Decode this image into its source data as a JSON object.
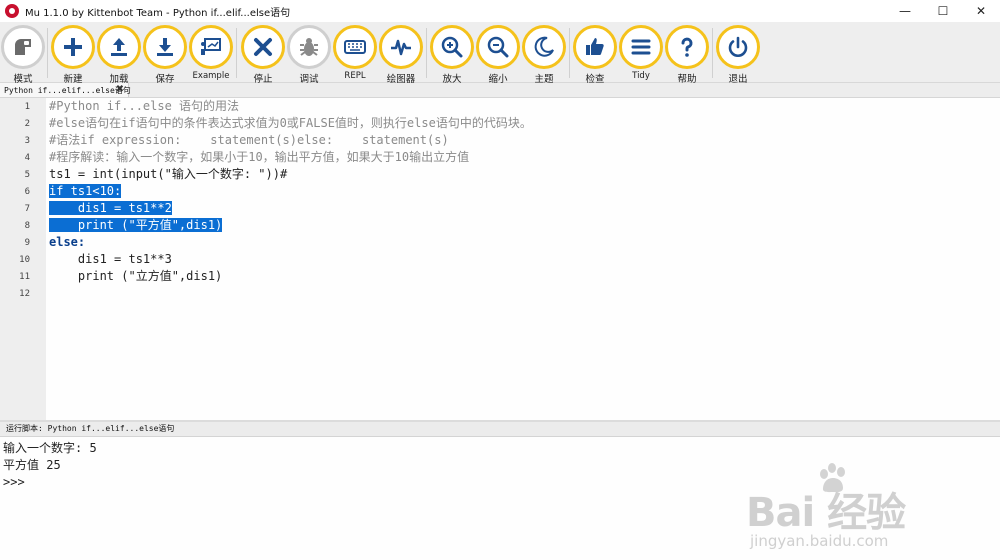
{
  "window": {
    "title": "Mu 1.1.0 by Kittenbot Team - Python if...elif...else语句",
    "minimize": "—",
    "maximize": "☐",
    "close": "✕"
  },
  "toolbar": {
    "accent_color": "#f5c21b",
    "icon_color": "#1d4f91",
    "buttons": [
      {
        "label": "模式",
        "icon": "mode-icon"
      },
      {
        "label": "新建",
        "icon": "plus-icon"
      },
      {
        "label": "加载",
        "icon": "upload-icon"
      },
      {
        "label": "保存",
        "icon": "download-icon"
      },
      {
        "label": "Example",
        "icon": "presentation-icon"
      },
      {
        "label": "停止",
        "icon": "stop-icon"
      },
      {
        "label": "调试",
        "icon": "bug-icon"
      },
      {
        "label": "REPL",
        "icon": "keyboard-icon"
      },
      {
        "label": "绘图器",
        "icon": "pulse-icon"
      },
      {
        "label": "放大",
        "icon": "zoom-in-icon"
      },
      {
        "label": "缩小",
        "icon": "zoom-out-icon"
      },
      {
        "label": "主题",
        "icon": "moon-icon"
      },
      {
        "label": "检查",
        "icon": "thumbs-up-icon"
      },
      {
        "label": "Tidy",
        "icon": "lines-icon"
      },
      {
        "label": "帮助",
        "icon": "question-icon"
      },
      {
        "label": "退出",
        "icon": "power-icon"
      }
    ]
  },
  "tab": {
    "label": "Python if...elif...else语句",
    "close": "✖"
  },
  "editor": {
    "selection_color": "#0b6ed3",
    "line_numbers": [
      "1",
      "2",
      "3",
      "4",
      "5",
      "6",
      "7",
      "8",
      "9",
      "10",
      "11",
      "12"
    ],
    "lines": [
      "#Python if...else 语句的用法",
      "#else语句在if语句中的条件表达式求值为0或FALSE值时，则执行else语句中的代码块。",
      "#语法if expression:    statement(s)else:    statement(s)",
      "#程序解读：输入一个数字，如果小于10，输出平方值，如果大于10输出立方值",
      "ts1 = int(input(\"输入一个数字: \"))#",
      "if ts1<10:",
      "    dis1 = ts1**2",
      "    print (\"平方值\",dis1)",
      "else:",
      "    dis1 = ts1**3",
      "    print (\"立方值\",dis1)",
      ""
    ]
  },
  "output": {
    "header": "运行脚本: Python if...elif...else语句",
    "lines": [
      "输入一个数字: 5",
      "平方值 25",
      ">>>"
    ]
  },
  "watermark": {
    "brand": "Bai  经验",
    "url": "jingyan.baidu.com"
  }
}
